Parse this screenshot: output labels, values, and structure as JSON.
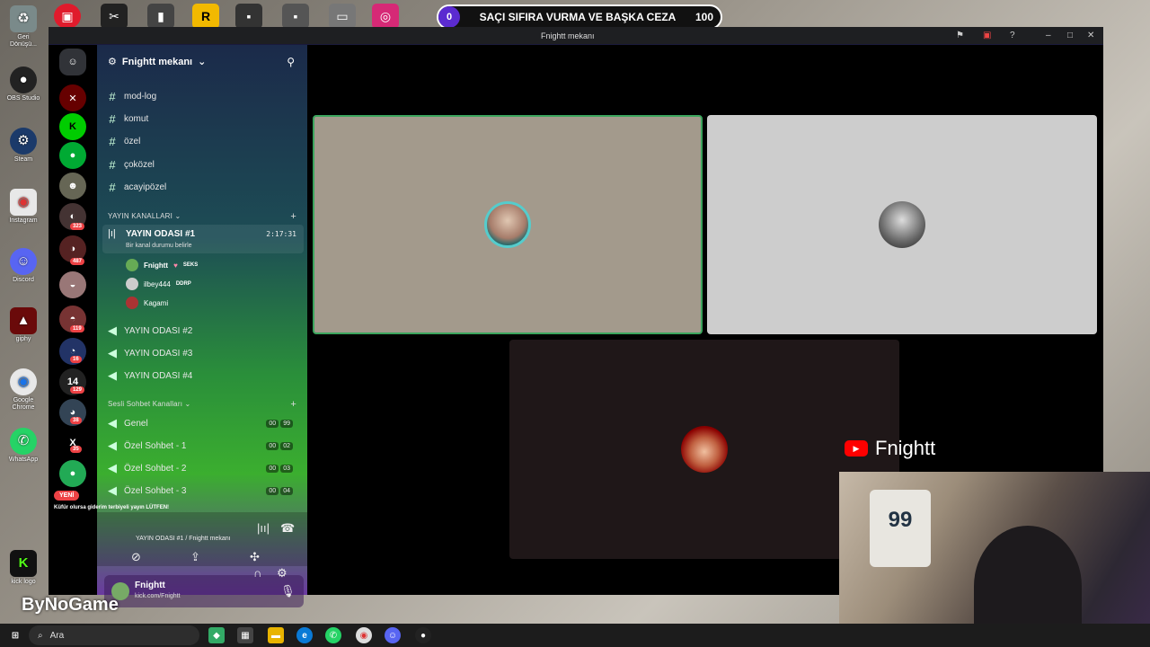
{
  "desktop_icons": [
    {
      "label": "Geri Dönüşü...",
      "icon": "recycle-bin-icon",
      "color": "#8aa"
    },
    {
      "label": "OBS Studio",
      "icon": "obs-icon",
      "color": "#222"
    },
    {
      "label": "Steam",
      "icon": "steam-icon",
      "color": "#1b2838"
    },
    {
      "label": "Instagram",
      "icon": "chrome-icon",
      "color": "#ddd"
    },
    {
      "label": "Discord",
      "icon": "discord-icon",
      "color": "#5865f2"
    },
    {
      "label": "giphy",
      "icon": "giphy-icon",
      "color": "#600"
    },
    {
      "label": "Google Chrome",
      "icon": "chrome-icon",
      "color": "#ddd"
    },
    {
      "label": "WhatsApp",
      "icon": "whatsapp-icon",
      "color": "#25d366"
    },
    {
      "label": "kick logo",
      "icon": "kick-icon",
      "color": "#53fc18"
    }
  ],
  "prediction": {
    "left": "0",
    "question": "SAÇI SIFIRA VURMA VE BAŞKA CEZA",
    "right": "100"
  },
  "window": {
    "title": "Fnightt mekanı"
  },
  "server": {
    "name": "Fnightt mekanı"
  },
  "text_channels": [
    "mod-log",
    "komut",
    "özel",
    "çoközel",
    "acayipözel"
  ],
  "yayin_category": "YAYIN KANALLARI",
  "active_voice": {
    "name": "YAYIN ODASI #1",
    "status": "Bir kanal durumu belirle",
    "duration": "2:17:31"
  },
  "voice_users": [
    {
      "name": "Fnightt",
      "tag": "SEKS"
    },
    {
      "name": "ilbey444",
      "tag": "DDRP"
    },
    {
      "name": "Kagami",
      "tag": ""
    }
  ],
  "other_yayin": [
    "YAYIN ODASI #2",
    "YAYIN ODASI #3",
    "YAYIN ODASI #4"
  ],
  "sesli_category": "Sesli Sohbet Kanalları",
  "sesli_channels": [
    {
      "name": "Genel",
      "a": "00",
      "b": "99"
    },
    {
      "name": "Özel Sohbet - 1",
      "a": "00",
      "b": "02"
    },
    {
      "name": "Özel Sohbet - 2",
      "a": "00",
      "b": "03"
    },
    {
      "name": "Özel Sohbet - 3",
      "a": "00",
      "b": "04"
    }
  ],
  "guild_badges": [
    "323",
    "487",
    "119",
    "16",
    "129",
    "38",
    "35"
  ],
  "new_label": "YENİ",
  "ticker": "Küfür olursa giderim terbiyeli yayın LÜTFEN!",
  "voice_connected": "YAYIN ODASI #1 / Fnightt mekanı",
  "user_panel": {
    "name": "Fnightt",
    "status": "kick.com/Fnightt"
  },
  "youtube_channel": "Fnightt",
  "webcam_shirt": "99",
  "bynogame": "ByNoGame",
  "taskbar": {
    "search_placeholder": "Ara"
  },
  "colors": {
    "speaking_border": "#3ba55d",
    "tile1": "#a39a8c",
    "tile2": "#cdcdcd",
    "tile3": "#1f1718"
  }
}
